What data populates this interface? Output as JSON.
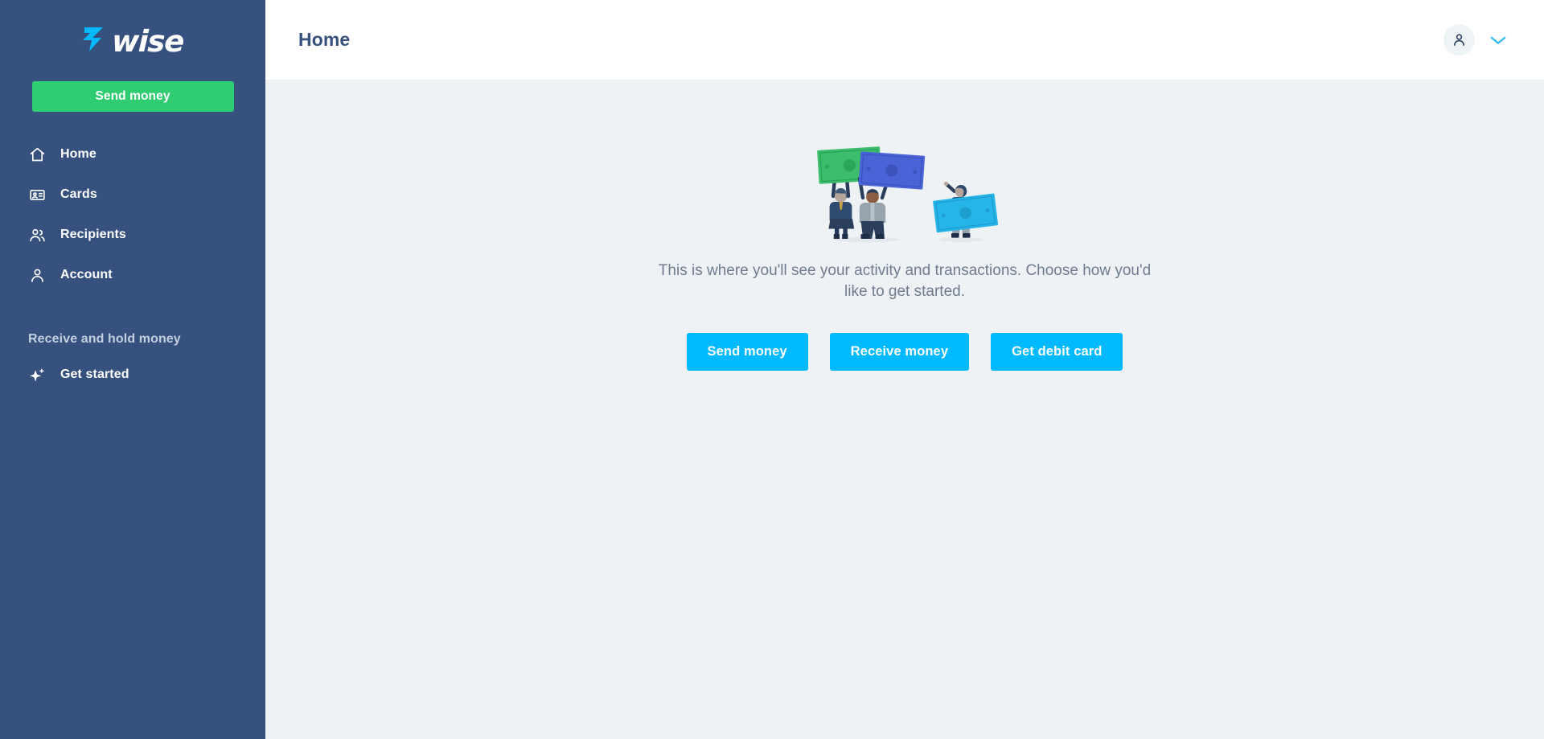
{
  "brand": {
    "name": "wise",
    "logo_icon": "wise-flag-mark",
    "sidebar_bg": "#37517e",
    "green": "#2fcc71",
    "cyan": "#00b9ff",
    "navy": "#37517e"
  },
  "sidebar": {
    "primary_action": {
      "label": "Send money",
      "color": "#2fcc71"
    },
    "items": [
      {
        "label": "Home",
        "icon": "home-icon",
        "active": true
      },
      {
        "label": "Cards",
        "icon": "card-icon",
        "active": false
      },
      {
        "label": "Recipients",
        "icon": "recipients-icon",
        "active": false
      },
      {
        "label": "Account",
        "icon": "person-icon",
        "active": false
      }
    ],
    "section_title": "Receive and hold money",
    "section_items": [
      {
        "label": "Get started",
        "icon": "sparkle-icon"
      }
    ]
  },
  "header": {
    "title": "Home",
    "avatar_icon": "person-icon",
    "dropdown_icon": "chevron-down-icon"
  },
  "main": {
    "illustration": "people-holding-banknotes",
    "empty_message": "This is where you'll see your activity and transactions. Choose how you'd like to get started.",
    "actions": [
      {
        "label": "Send money"
      },
      {
        "label": "Receive money"
      },
      {
        "label": "Get debit card"
      }
    ]
  }
}
